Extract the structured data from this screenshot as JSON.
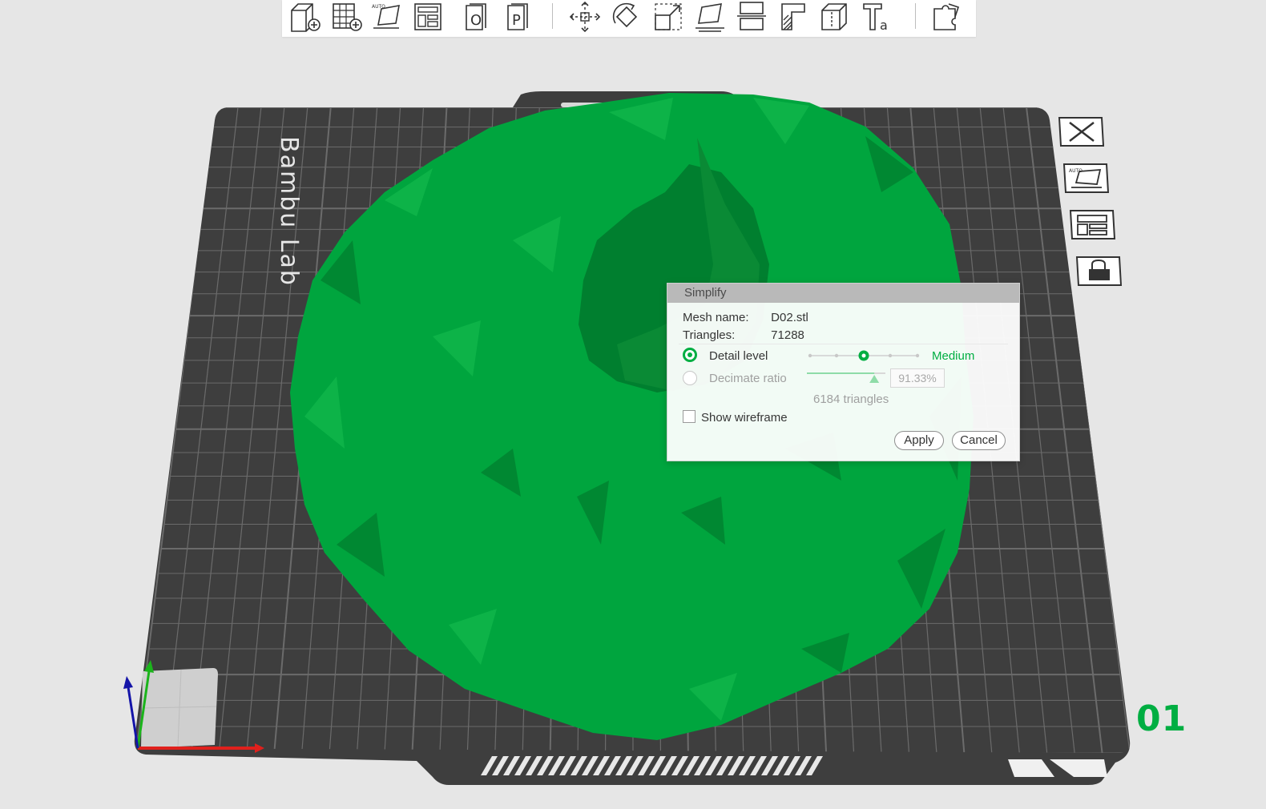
{
  "toolbar": {
    "icons": [
      "add-object-icon",
      "add-plate-icon",
      "auto-orient-icon",
      "arrange-icon",
      "split-to-objects-icon",
      "split-to-parts-icon",
      "move-icon",
      "rotate-icon",
      "scale-icon",
      "lay-on-face-icon",
      "cut-icon",
      "support-paint-icon",
      "seam-paint-icon",
      "text-icon",
      "assembly-icon"
    ]
  },
  "plate": {
    "brand": "Bambu Lab",
    "number": "01",
    "side_buttons": [
      "delete-plate-icon",
      "auto-orient-plate-icon",
      "arrange-plate-icon",
      "lock-plate-icon"
    ]
  },
  "model": {
    "color": "#00a53e",
    "shade_dark": "#007f2f",
    "shade_light": "#11b84c"
  },
  "dialog": {
    "title": "Simplify",
    "mesh_name_label": "Mesh name:",
    "mesh_name_value": "D02.stl",
    "triangles_label": "Triangles:",
    "triangles_value": "71288",
    "detail_level_label": "Detail level",
    "detail_level_value": "Medium",
    "detail_level_selected": true,
    "decimate_ratio_label": "Decimate ratio",
    "decimate_ratio_value": "91.33%",
    "decimate_ratio_fraction": 0.9133,
    "result_triangles": "6184 triangles",
    "show_wireframe_label": "Show wireframe",
    "show_wireframe_checked": false,
    "apply_label": "Apply",
    "cancel_label": "Cancel"
  },
  "colors": {
    "accent": "#00ae42",
    "plate": "#3e3e3e",
    "grid": "#6b6b6b",
    "background": "#e6e6e6"
  }
}
